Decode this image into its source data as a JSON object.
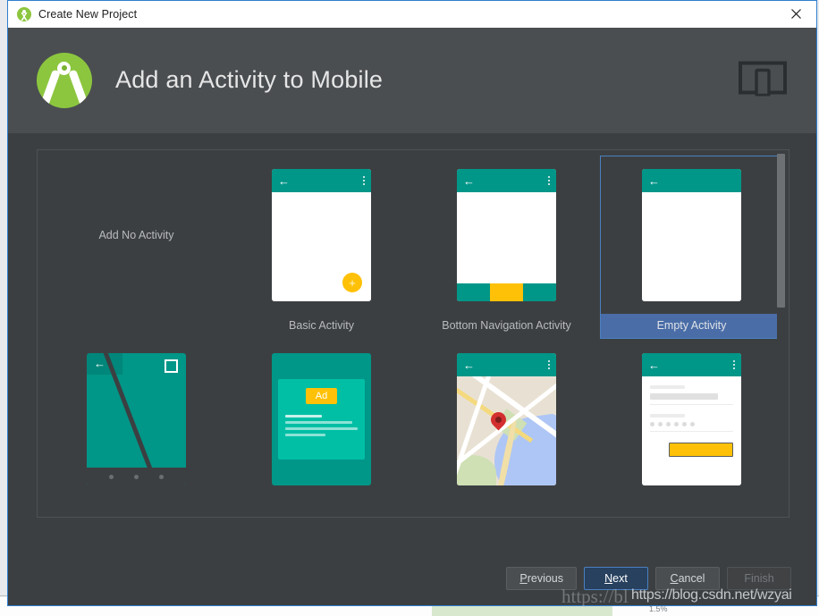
{
  "window": {
    "title": "Create New Project",
    "app_icon": "android-studio-icon",
    "close_label": "×"
  },
  "header": {
    "title": "Add an Activity to Mobile",
    "logo": "android-studio-logo",
    "form_factor_icon": "mobile-device-icon"
  },
  "gallery": {
    "templates": [
      {
        "id": "no-activity",
        "label": "Add No Activity",
        "art": "none",
        "selected": false
      },
      {
        "id": "basic-activity",
        "label": "Basic Activity",
        "art": "phone-fab",
        "selected": false
      },
      {
        "id": "bottom-navigation-activity",
        "label": "Bottom Navigation Activity",
        "art": "phone-bottomnav",
        "selected": false
      },
      {
        "id": "empty-activity",
        "label": "Empty Activity",
        "art": "phone-empty",
        "selected": true
      },
      {
        "id": "fullscreen-activity",
        "label": "",
        "art": "fullscreen",
        "selected": false
      },
      {
        "id": "ads-activity",
        "label": "",
        "art": "ad",
        "selected": false
      },
      {
        "id": "maps-activity",
        "label": "",
        "art": "map",
        "selected": false
      },
      {
        "id": "login-activity",
        "label": "",
        "art": "login",
        "selected": false
      }
    ],
    "ad_badge": "Ad"
  },
  "footer": {
    "previous": "Previous",
    "previous_mnemonic": "P",
    "next": "Next",
    "next_mnemonic": "N",
    "cancel": "Cancel",
    "cancel_mnemonic": "C",
    "finish": "Finish"
  },
  "watermarks": {
    "faint": "https://bl",
    "bold": "https://blog.csdn.net/wzyai"
  },
  "background": {
    "percent_label": "1.5%"
  },
  "colors": {
    "dialog_bg": "#3c3f41",
    "header_bg": "#4a4e51",
    "selection_blue": "#4a6da7",
    "border_blue": "#4a80c0",
    "teal": "#009688",
    "amber": "#ffc107",
    "android_green": "#8cc63f"
  }
}
